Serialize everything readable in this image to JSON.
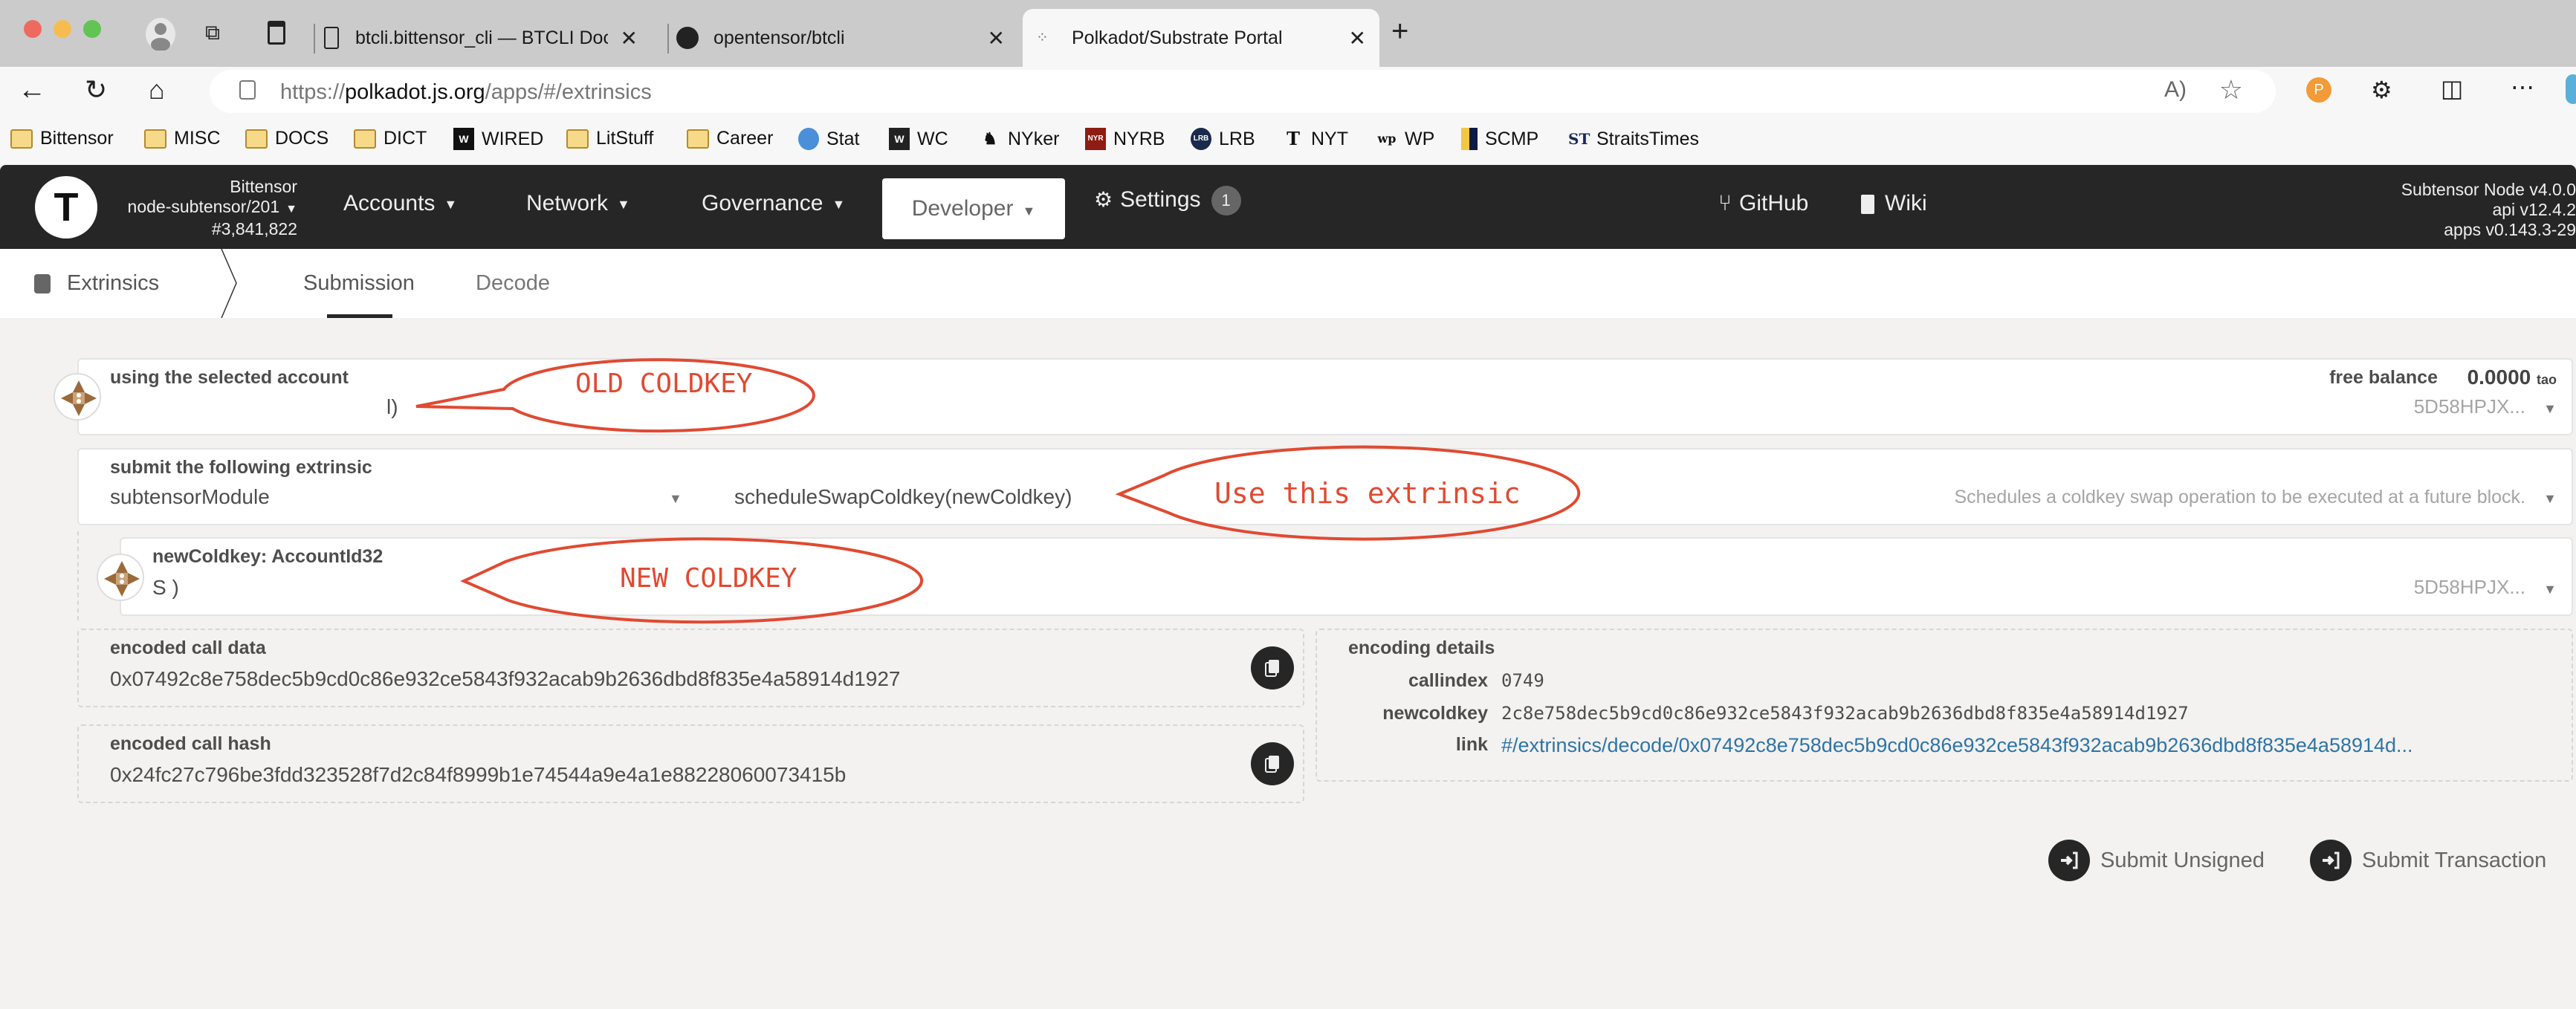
{
  "browser": {
    "tabs": [
      {
        "title": "btcli.bittensor_cli — BTCLI Docs",
        "icon": "document-icon",
        "active": false
      },
      {
        "title": "opentensor/btcli",
        "icon": "github-icon",
        "active": false
      },
      {
        "title": "Polkadot/Substrate Portal",
        "icon": "polkadot-icon",
        "active": true
      }
    ],
    "new_tab": "+",
    "close": "✕",
    "url_prefix": "https://",
    "url_host": "polkadot.js.org",
    "url_path": "/apps/#/extrinsics",
    "bookmarks": [
      {
        "label": "Bittensor",
        "icon": "folder-icon"
      },
      {
        "label": "MISC",
        "icon": "folder-icon"
      },
      {
        "label": "DOCS",
        "icon": "folder-icon"
      },
      {
        "label": "DICT",
        "icon": "folder-icon"
      },
      {
        "label": "WIRED",
        "icon": "wired-icon"
      },
      {
        "label": "LitStuff",
        "icon": "folder-icon"
      },
      {
        "label": "Career",
        "icon": "folder-icon"
      },
      {
        "label": "Stat",
        "icon": "stat-icon"
      },
      {
        "label": "WC",
        "icon": "wc-icon"
      },
      {
        "label": "NYker",
        "icon": "nyker-icon"
      },
      {
        "label": "NYRB",
        "icon": "nyrb-icon"
      },
      {
        "label": "LRB",
        "icon": "lrb-icon"
      },
      {
        "label": "NYT",
        "icon": "nyt-icon"
      },
      {
        "label": "WP",
        "icon": "wp-icon"
      },
      {
        "label": "SCMP",
        "icon": "scmp-icon"
      },
      {
        "label": "StraitsTimes",
        "icon": "straitstimes-icon"
      }
    ]
  },
  "app": {
    "chain": {
      "name": "Bittensor",
      "node": "node-subtensor/201",
      "block": "#3,841,822"
    },
    "nav": {
      "accounts": "Accounts",
      "network": "Network",
      "governance": "Governance",
      "developer": "Developer",
      "settings": "Settings",
      "settings_badge": "1",
      "github": "GitHub",
      "wiki": "Wiki"
    },
    "versions": {
      "node": "Subtensor Node v4.0.0",
      "api": "api v12.4.2",
      "apps": "apps v0.143.3-29"
    },
    "subnav": {
      "section": "Extrinsics",
      "tabs": [
        "Submission",
        "Decode"
      ],
      "active_tab": "Submission"
    }
  },
  "form": {
    "account": {
      "label": "using the selected account",
      "value": "l)",
      "free_balance_label": "free balance",
      "free_balance_value": "0.0000",
      "free_balance_unit": "tao",
      "address": "5D58HPJX..."
    },
    "extrinsic": {
      "label": "submit the following extrinsic",
      "module": "subtensorModule",
      "method": "scheduleSwapColdkey(newColdkey)",
      "description": "Schedules a coldkey swap operation to be executed at a future block."
    },
    "param": {
      "label": "newColdkey: AccountId32",
      "value": "S                  )",
      "address": "5D58HPJX..."
    },
    "encoded_call_data": {
      "label": "encoded call data",
      "value": "0x07492c8e758dec5b9cd0c86e932ce5843f932acab9b2636dbd8f835e4a58914d1927"
    },
    "encoded_call_hash": {
      "label": "encoded call hash",
      "value": "0x24fc27c796be3fdd323528f7d2c84f8999b1e74544a9e4a1e88228060073415b"
    },
    "encoding_details": {
      "label": "encoding details",
      "callindex_label": "callindex",
      "callindex": "0749",
      "newcoldkey_label": "newcoldkey",
      "newcoldkey": "2c8e758dec5b9cd0c86e932ce5843f932acab9b2636dbd8f835e4a58914d1927",
      "link_label": "link",
      "link": "#/extrinsics/decode/0x07492c8e758dec5b9cd0c86e932ce5843f932acab9b2636dbd8f835e4a58914d..."
    },
    "buttons": {
      "submit_unsigned": "Submit Unsigned",
      "submit_transaction": "Submit Transaction"
    }
  },
  "annotations": {
    "old_coldkey": "OLD COLDKEY",
    "use_extrinsic": "Use this extrinsic",
    "new_coldkey": "NEW COLDKEY",
    "color": "#e04a32"
  }
}
